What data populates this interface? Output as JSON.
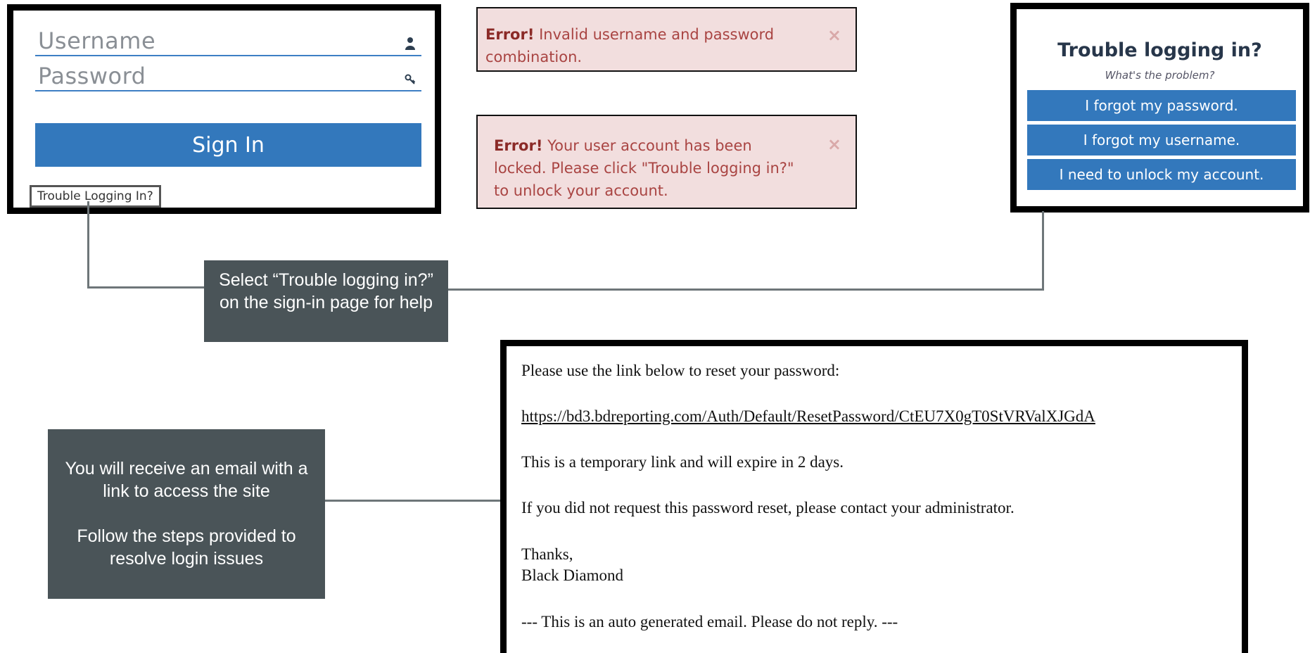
{
  "login": {
    "username_label": "Username",
    "password_label": "Password",
    "signin_label": "Sign In",
    "trouble_link": "Trouble Logging In?"
  },
  "alerts": {
    "invalid": {
      "strong": "Error!",
      "text": " Invalid username and password combination.",
      "close": "×"
    },
    "locked": {
      "strong": "Error!",
      "text": " Your user account has been locked. Please click \"Trouble logging in?\" to unlock your account.",
      "close": "×"
    }
  },
  "trouble": {
    "title": "Trouble logging in?",
    "subtitle": "What's the problem?",
    "buttons": [
      "I forgot my password.",
      "I forgot my username.",
      "I need to unlock my account."
    ]
  },
  "callouts": {
    "trouble": "Select “Trouble logging in?” on the sign-in page for help",
    "email_line1": "You will receive an email with a link to access the site",
    "email_line2": "Follow the steps provided to resolve login issues"
  },
  "email": {
    "line1": "Please use the link below to reset your password:",
    "link": "https://bd3.bdreporting.com/Auth/Default/ResetPassword/CtEU7X0gT0StVRValXJGdA",
    "line2": "This is a temporary link and will expire in 2 days.",
    "line3": "If you did not request this password reset, please contact your administrator.",
    "thanks": "Thanks,",
    "signature": "Black Diamond",
    "footer": "--- This is an auto generated email.  Please do not reply. ---"
  },
  "colors": {
    "button_blue": "#3378bc",
    "alert_bg": "#f2dede",
    "alert_text": "#a94442",
    "callout_bg": "#4a5458",
    "link": "#1a0dab"
  },
  "icons": {
    "username": "user-icon",
    "password": "key-icon",
    "close": "close-icon"
  }
}
